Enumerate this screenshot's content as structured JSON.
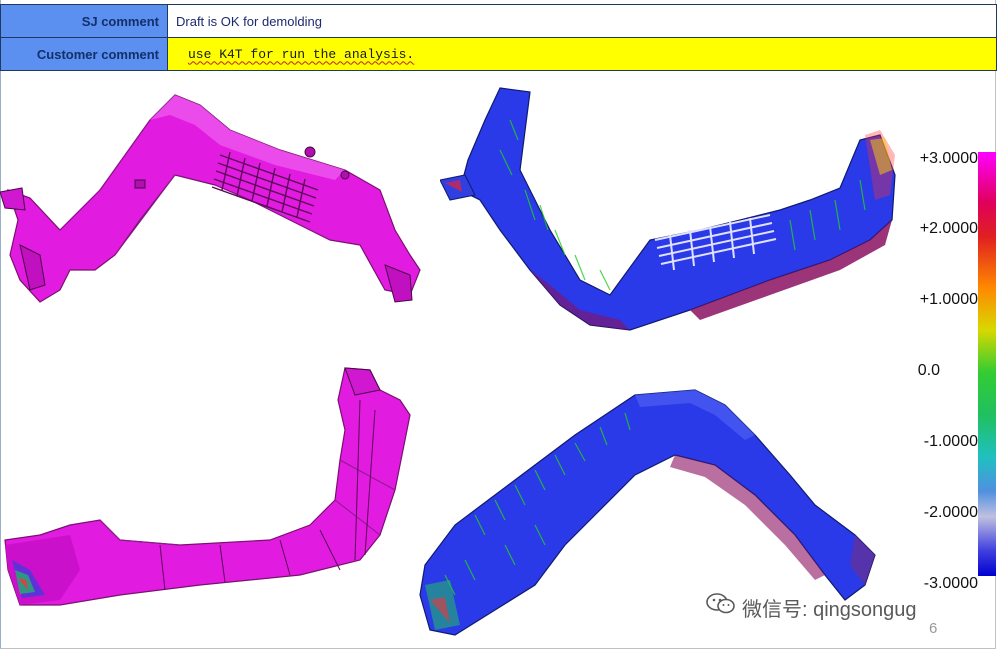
{
  "comments": {
    "sj_label": "SJ comment",
    "sj_value": "Draft is OK for demolding",
    "customer_label": "Customer comment",
    "customer_value": "use K4T for run the analysis."
  },
  "legend": {
    "ticks": [
      "+3.0000",
      "+2.0000",
      "+1.0000",
      "0.0",
      "-1.0000",
      "-2.0000",
      "-3.0000"
    ]
  },
  "watermark": {
    "text": "微信号: qingsongug",
    "icon": "wechat-icon"
  },
  "page_number": "6",
  "colors": {
    "label_bg": "#5b8ff0",
    "customer_bg": "#ffff00",
    "part_magenta": "#e000e0",
    "part_blue": "#2a3ae8"
  }
}
